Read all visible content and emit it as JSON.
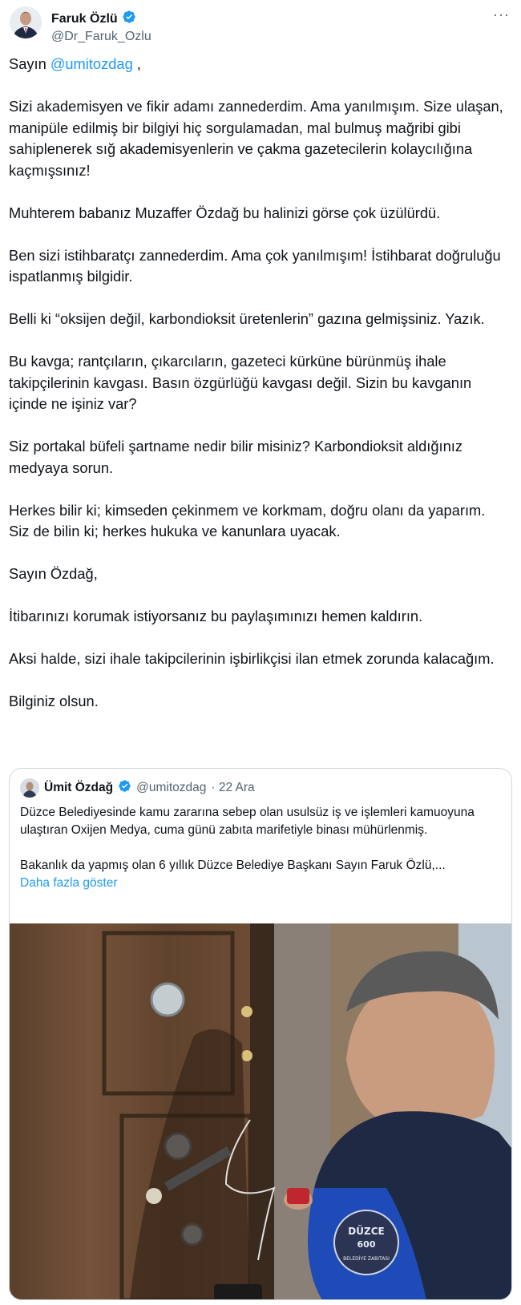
{
  "author": {
    "name": "Faruk Özlü",
    "handle": "@Dr_Faruk_Ozlu",
    "more": "···"
  },
  "tweet": {
    "greeting_prefix": "Sayın ",
    "mention": "@umitozdag",
    "greeting_suffix": " ,",
    "paragraphs": [
      "Sizi akademisyen ve fikir adamı zannederdim. Ama yanılmışım. Size ulaşan, manipüle edilmiş bir bilgiyi hiç sorgulamadan, mal bulmuş mağribi gibi sahiplenerek sığ akademisyenlerin ve çakma gazetecilerin kolaycılığına kaçmışsınız!",
      "Muhterem babanız Muzaffer Özdağ bu halinizi görse çok üzülürdü.",
      "Ben sizi istihbaratçı zannederdim. Ama çok yanılmışım! İstihbarat doğruluğu ispatlanmış bilgidir.",
      "Belli ki “oksijen değil, karbondioksit üretenlerin” gazına gelmişsiniz. Yazık.",
      "Bu kavga; rantçıların, çıkarcıların, gazeteci kürküne bürünmüş ihale takipçilerinin kavgası. Basın özgürlüğü kavgası değil. Sizin bu kavganın içinde ne işiniz var?",
      "Siz portakal büfeli şartname nedir bilir misiniz? Karbondioksit aldığınız medyaya sorun.",
      "Herkes bilir ki; kimseden çekinmem  ve korkmam, doğru olanı da yaparım. Siz de bilin ki; herkes hukuka ve kanunlara uyacak.",
      "Sayın Özdağ,",
      "İtibarınızı korumak istiyorsanız bu paylaşımınızı hemen kaldırın.",
      "Aksi halde, sizi ihale takipcilerinin işbirlikçisi ilan etmek zorunda kalacağım.",
      "Bilginiz olsun."
    ]
  },
  "quote": {
    "name": "Ümit Özdağ",
    "handle": "@umitozdag",
    "date": "· 22 Ara",
    "paragraphs": [
      "Düzce Belediyesinde kamu zararına sebep olan usulsüz iş ve işlemleri kamuoyuna ulaştıran Oxijen Medya, cuma günü zabıta marifetiyle binası mühürlenmiş.",
      "Bakanlık da yapmış olan 6 yıllık Düzce Belediye Başkanı Sayın Faruk Özlü,..."
    ],
    "show_more": "Daha fazla göster",
    "badge_line1": "DÜZCE",
    "badge_line2": "600",
    "badge_line3": "BELEDİYE ZABITASI"
  },
  "colors": {
    "link": "#1d9bf0",
    "verified": "#1d9bf0",
    "secondary_text": "#536471",
    "border": "#cfd9de"
  },
  "icons": [
    "verified-badge-icon",
    "more-options-icon"
  ]
}
